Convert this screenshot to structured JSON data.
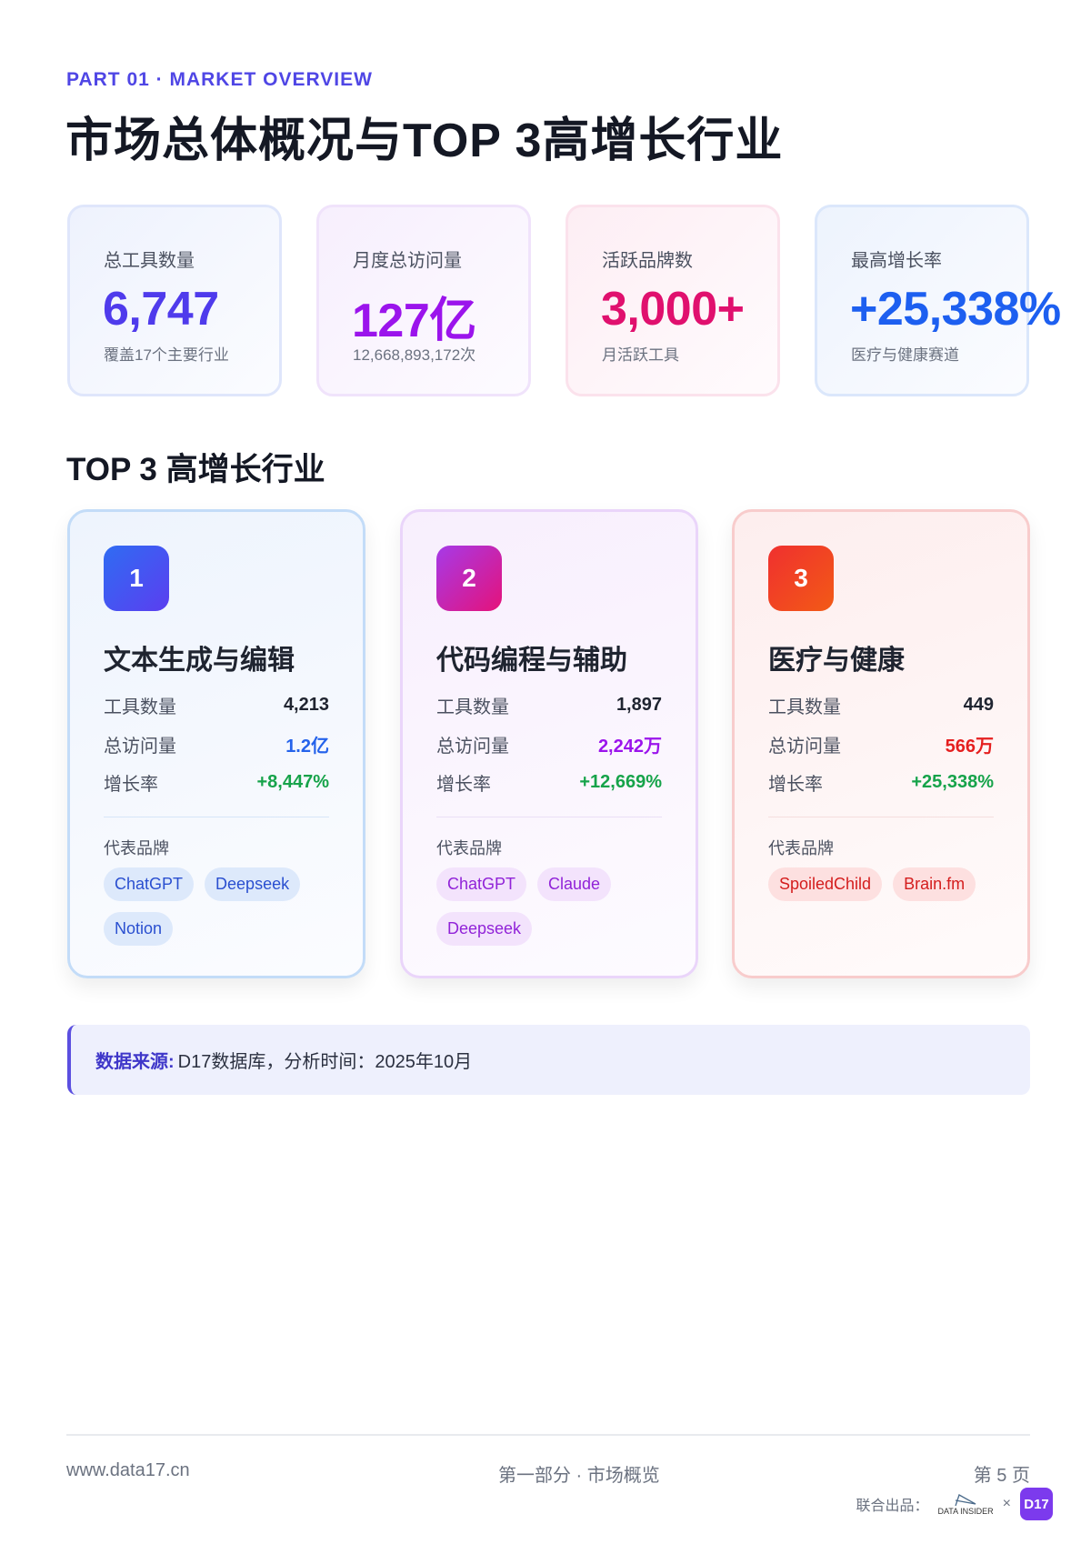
{
  "header": {
    "part": "PART 01 · MARKET OVERVIEW",
    "title": "市场总体概况与TOP 3高增长行业"
  },
  "stats": [
    {
      "label": "总工具数量",
      "value": "6,747",
      "sub": "覆盖17个主要行业",
      "color": "#4f3bec"
    },
    {
      "label": "月度总访问量",
      "value": "127亿",
      "sub": "12,668,893,172次",
      "color": "#9b14ec"
    },
    {
      "label": "活跃品牌数",
      "value": "3,000+",
      "sub": "月活跃工具",
      "color": "#e0106e"
    },
    {
      "label": "最高增长率",
      "value": "+25,338%",
      "sub": "医疗与健康赛道",
      "color": "#1d5ff0"
    }
  ],
  "section_title": "TOP 3 高增长行业",
  "industries": [
    {
      "rank": "1",
      "name": "文本生成与编辑",
      "rows": [
        {
          "k": "工具数量",
          "v": "4,213"
        },
        {
          "k": "总访问量",
          "v": "1.2亿"
        },
        {
          "k": "增长率",
          "v": "+8,447%"
        }
      ],
      "brands_label": "代表品牌",
      "brands": [
        "ChatGPT",
        "Deepseek",
        "Notion"
      ]
    },
    {
      "rank": "2",
      "name": "代码编程与辅助",
      "rows": [
        {
          "k": "工具数量",
          "v": "1,897"
        },
        {
          "k": "总访问量",
          "v": "2,242万"
        },
        {
          "k": "增长率",
          "v": "+12,669%"
        }
      ],
      "brands_label": "代表品牌",
      "brands": [
        "ChatGPT",
        "Claude",
        "Deepseek"
      ]
    },
    {
      "rank": "3",
      "name": "医疗与健康",
      "rows": [
        {
          "k": "工具数量",
          "v": "449"
        },
        {
          "k": "总访问量",
          "v": "566万"
        },
        {
          "k": "增长率",
          "v": "+25,338%"
        }
      ],
      "brands_label": "代表品牌",
      "brands": [
        "SpoiledChild",
        "Brain.fm"
      ]
    }
  ],
  "source": {
    "label": "数据来源:",
    "text": "D17数据库，分析时间：2025年10月"
  },
  "footer": {
    "url": "www.data17.cn",
    "section": "第一部分 · 市场概览",
    "page": "第 5 页",
    "joint": "联合出品：",
    "logo1": "DATA INSIDER",
    "x": "×",
    "logo2": "D17"
  }
}
